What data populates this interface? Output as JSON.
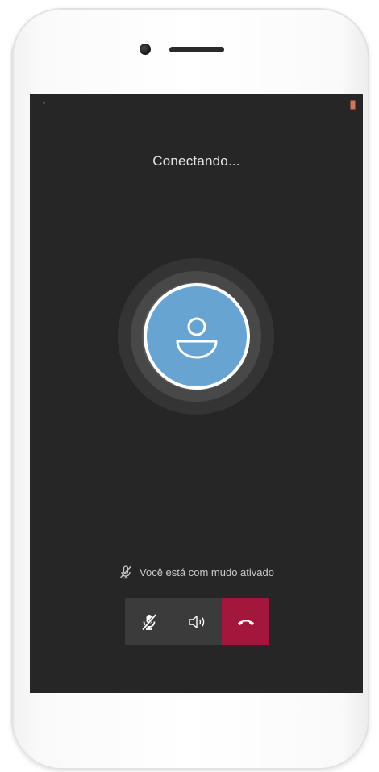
{
  "call": {
    "status": "Conectando...",
    "mute_notice": "Você está com mudo ativado"
  },
  "controls": [
    {
      "name": "mute-button",
      "icon": "microphone-off-icon",
      "state": "muted"
    },
    {
      "name": "speaker-button",
      "icon": "speaker-icon"
    },
    {
      "name": "hangup-button",
      "icon": "phone-hangup-icon",
      "color": "#a4173c"
    }
  ],
  "colors": {
    "screen_bg": "#262626",
    "avatar_blue": "#68a4d2",
    "hangup_red": "#a4173c",
    "control_bg": "#3b3b3b"
  },
  "icons": {
    "avatar": "person-icon",
    "notice": "microphone-off-icon",
    "battery": "battery-icon"
  }
}
